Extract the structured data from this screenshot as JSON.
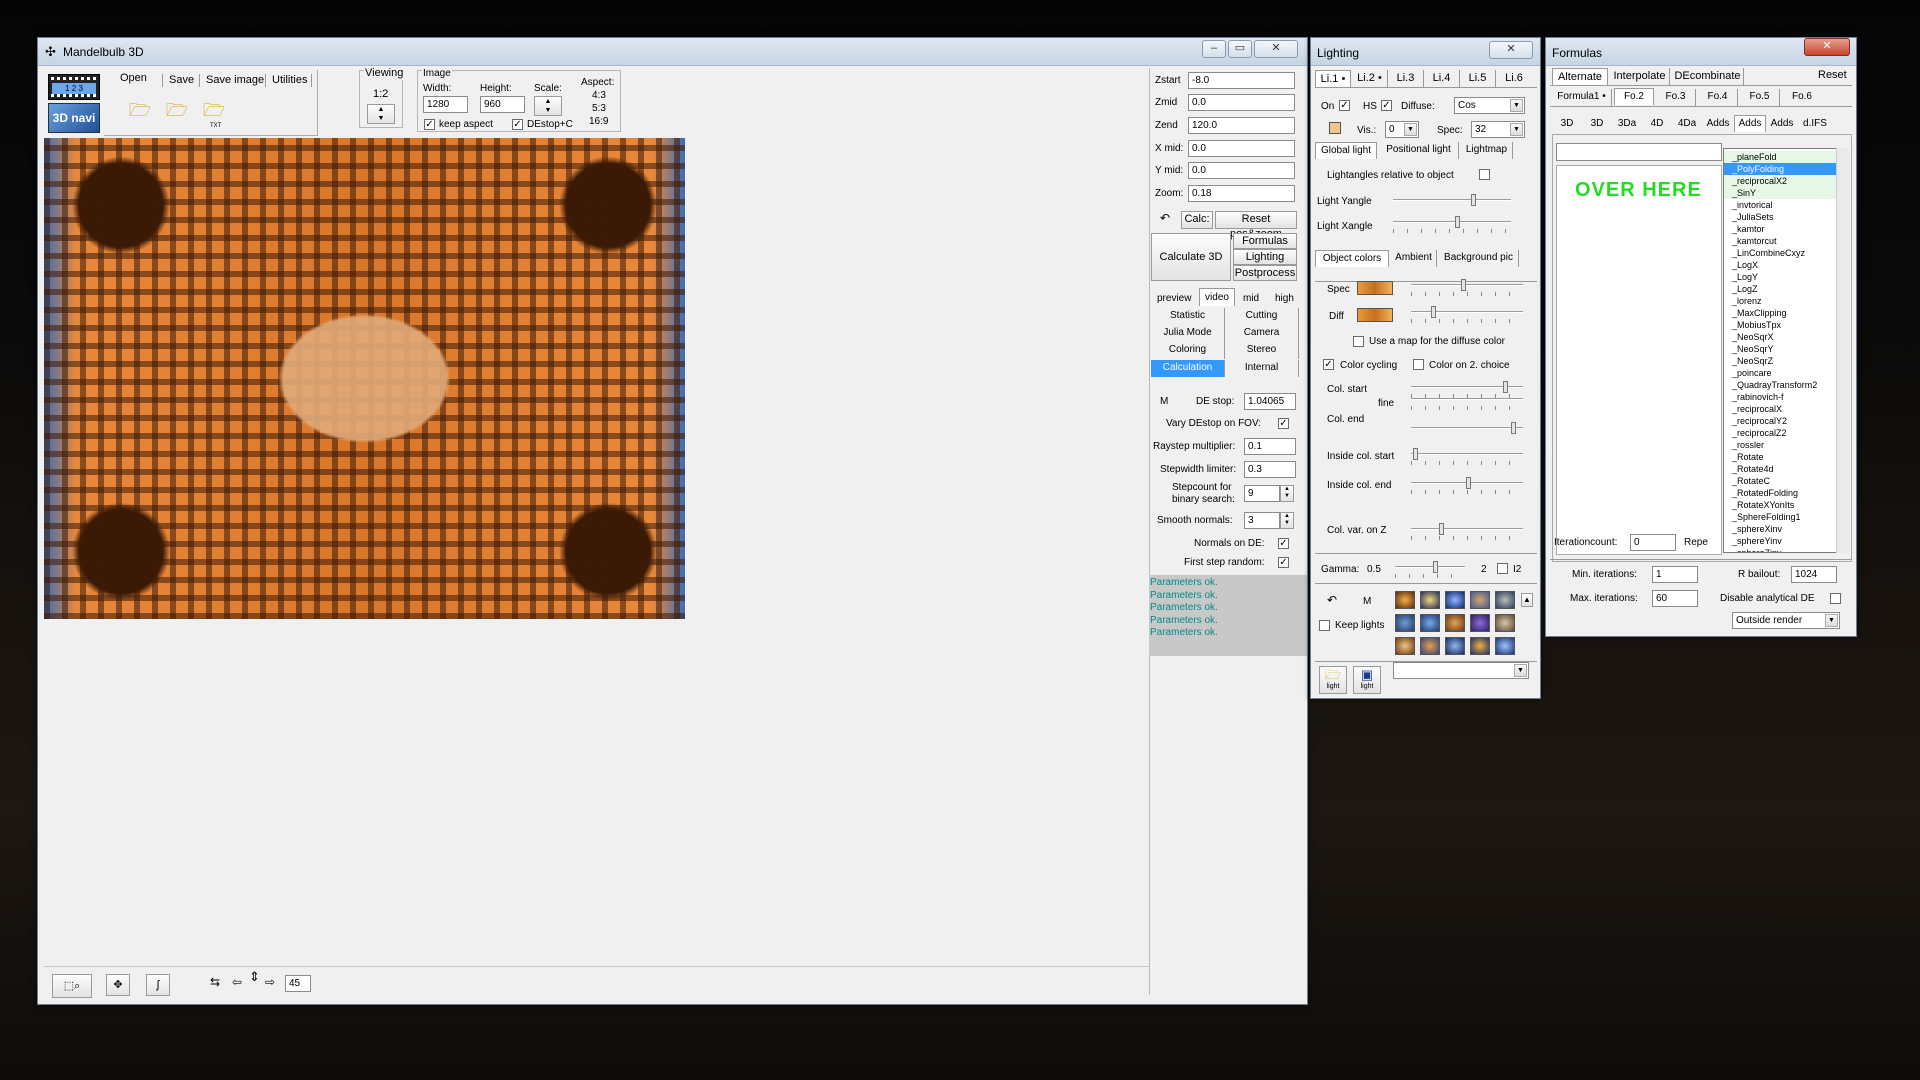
{
  "main_window": {
    "title": "Mandelbulb 3D",
    "menu": {
      "open": "Open",
      "save": "Save",
      "save_image": "Save image",
      "utilities": "Utilities"
    },
    "film_label": "1 2 3",
    "navi_label": "3D navi",
    "file_icon_label": "TXT",
    "viewing": {
      "label": "Viewing",
      "ratio": "1:2"
    },
    "image": {
      "label": "Image",
      "width_label": "Width:",
      "width": "1280",
      "height_label": "Height:",
      "height": "960",
      "scale_label": "Scale:",
      "keep_aspect": "keep aspect",
      "destop": "DEstop+C",
      "aspect_label": "Aspect:",
      "aspects": [
        "4:3",
        "5:3",
        "16:9"
      ]
    },
    "params": [
      {
        "label": "Zstart",
        "value": "-8.0"
      },
      {
        "label": "Zmid",
        "value": "0.0"
      },
      {
        "label": "Zend",
        "value": "120.0"
      },
      {
        "label": "X mid:",
        "value": "0.0"
      },
      {
        "label": "Y mid:",
        "value": "0.0"
      },
      {
        "label": "Zoom:",
        "value": "0.18"
      }
    ],
    "calc_btn": "Calc:",
    "reset_btn": "Reset pos&zoom",
    "calc3d_btn": "Calculate 3D",
    "side_btns": [
      "Formulas",
      "Lighting",
      "Postprocess"
    ],
    "quality": [
      "preview",
      "video",
      "mid",
      "high"
    ],
    "nav_tabs": [
      "Statistic",
      "Cutting",
      "Julia Mode",
      "Camera",
      "Coloring",
      "Stereo",
      "Calculation",
      "Internal"
    ],
    "calc": {
      "m": "M",
      "destop_label": "DE stop:",
      "destop": "1.04065",
      "vary": "Vary DEstop on FOV:",
      "raystep_label": "Raystep multiplier:",
      "raystep": "0.1",
      "stepwidth_label": "Stepwidth limiter:",
      "stepwidth": "0.3",
      "stepcount_label1": "Stepcount for",
      "stepcount_label2": "binary search:",
      "stepcount": "9",
      "smooth_label": "Smooth  normals:",
      "smooth": "3",
      "normals_label": "Normals on DE:",
      "firststep_label": "First step random:"
    },
    "log": [
      "Parameters ok.",
      "Parameters ok.",
      "Parameters ok.",
      "Parameters ok.",
      "Parameters ok."
    ],
    "bottom_value": "45"
  },
  "lighting_window": {
    "title": "Lighting",
    "light_tabs": [
      "Li.1 •",
      "Li.2 •",
      "Li.3",
      "Li.4",
      "Li.5",
      "Li.6"
    ],
    "on": "On",
    "hs": "HS",
    "diffuse_label": "Diffuse:",
    "diffuse": "Cos",
    "vis_label": "Vis.:",
    "vis": "0",
    "spec_label": "Spec:",
    "spec": "32",
    "light_sub_tabs": [
      "Global light",
      "Positional light",
      "Lightmap"
    ],
    "lightangles": "Lightangles relative to object",
    "yangle": "Light Yangle",
    "xangle": "Light Xangle",
    "color_tabs": [
      "Object colors",
      "Ambient",
      "Background pic"
    ],
    "spec_swatch": "Spec",
    "diff_swatch": "Diff",
    "use_map": "Use a map for the diffuse color",
    "color_cycling": "Color cycling",
    "color_on2": "Color on 2. choice",
    "col_start": "Col. start",
    "fine": "fine",
    "col_end": "Col. end",
    "inside_start": "Inside col. start",
    "inside_end": "Inside col. end",
    "col_var": "Col. var. on Z",
    "gamma_label": "Gamma:",
    "gamma": "0.5",
    "gamma_max": "2",
    "i2": "I2",
    "m": "M",
    "keep_lights": "Keep lights",
    "light_icon_label": "light"
  },
  "formulas_window": {
    "title": "Formulas",
    "mode_tabs": [
      "Alternate",
      "Interpolate",
      "DEcombinate"
    ],
    "reset": "Reset",
    "formula_tabs": [
      "Formula1 •",
      "Fo.2",
      "Fo.3",
      "Fo.4",
      "Fo.5",
      "Fo.6"
    ],
    "type_tabs": [
      "3D",
      "3D",
      "3Da",
      "4D",
      "4Da",
      "Adds",
      "Adds",
      "Adds",
      "d.IFS"
    ],
    "over_here": "OVER HERE",
    "list": [
      "_planeFold",
      "_PolyFolding",
      "_reciprocalX2",
      "_SinY",
      "_invtorical",
      "_JuliaSets",
      "_kamtor",
      "_kamtorcut",
      "_LinCombineCxyz",
      "_LogX",
      "_LogY",
      "_LogZ",
      "_lorenz",
      "_MaxClipping",
      "_MobiusTpx",
      "_NeoSqrX",
      "_NeoSqrY",
      "_NeoSqrZ",
      "_poincare",
      "_QuadrayTransform2",
      "_rabinovich-f",
      "_reciprocalX",
      "_reciprocalY2",
      "_reciprocalZ2",
      "_rossler",
      "_Rotate",
      "_Rotate4d",
      "_RotateC",
      "_RotatedFolding",
      "_RotateXYonIts",
      "_SphereFolding1",
      "_sphereXinv",
      "_sphereYinv",
      "_sphereZinv"
    ],
    "selected_index": 1,
    "iterationcount_label": "Iterationcount:",
    "iterationcount": "0",
    "repeat": "Repe",
    "min_iter_label": "Min. iterations:",
    "min_iter": "1",
    "rbailout_label": "R bailout:",
    "rbailout": "1024",
    "max_iter_label": "Max. iterations:",
    "max_iter": "60",
    "disable_de": "Disable analytical DE",
    "outside_render": "Outside render"
  },
  "colors": {
    "accent": "#3399ff",
    "log_text": "#008b8b",
    "over_here": "#22dd22"
  }
}
